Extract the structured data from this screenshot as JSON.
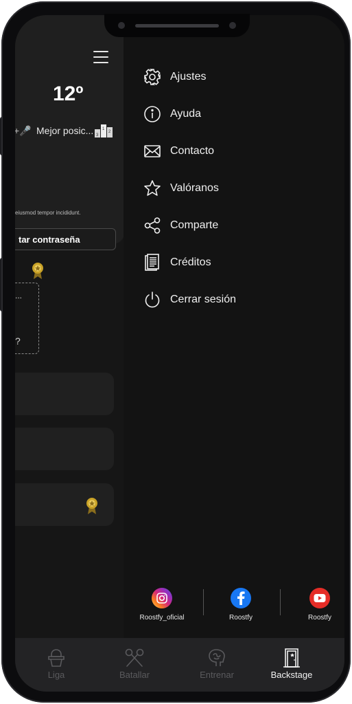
{
  "status": {},
  "background": {
    "level": "12º",
    "best_position_prefix": "+🎤",
    "best_position_label": "Mejor posic...",
    "podium_digits": [
      "3",
      "1",
      "2"
    ],
    "lorem": "eiusmod tempor incididunt.",
    "change_password_label": "tar contraseña",
    "card_dots": "...",
    "card_question": "?"
  },
  "drawer": {
    "items": [
      {
        "label": "Ajustes",
        "icon": "gear-icon"
      },
      {
        "label": "Ayuda",
        "icon": "info-icon"
      },
      {
        "label": "Contacto",
        "icon": "mail-icon"
      },
      {
        "label": "Valóranos",
        "icon": "star-icon"
      },
      {
        "label": "Comparte",
        "icon": "share-icon"
      },
      {
        "label": "Créditos",
        "icon": "document-icon"
      },
      {
        "label": "Cerrar sesión",
        "icon": "power-icon"
      }
    ],
    "social": [
      {
        "name": "Roostfy_oficial",
        "icon": "instagram-icon",
        "color": "#d62976"
      },
      {
        "name": "Roostfy",
        "icon": "facebook-icon",
        "color": "#1877f2"
      },
      {
        "name": "Roostfy",
        "icon": "youtube-icon",
        "color": "#ff0000"
      }
    ]
  },
  "tabs": [
    {
      "label": "Liga",
      "icon": "league-icon",
      "active": false
    },
    {
      "label": "Batallar",
      "icon": "microphones-icon",
      "active": false
    },
    {
      "label": "Entrenar",
      "icon": "brain-icon",
      "active": false
    },
    {
      "label": "Backstage",
      "icon": "door-icon",
      "active": true
    }
  ],
  "colors": {
    "drawer_bg": "#131313",
    "tab_active": "#f2f2f2",
    "tab_inactive": "#5a5a5d",
    "badge_gold": "#c9a227"
  }
}
